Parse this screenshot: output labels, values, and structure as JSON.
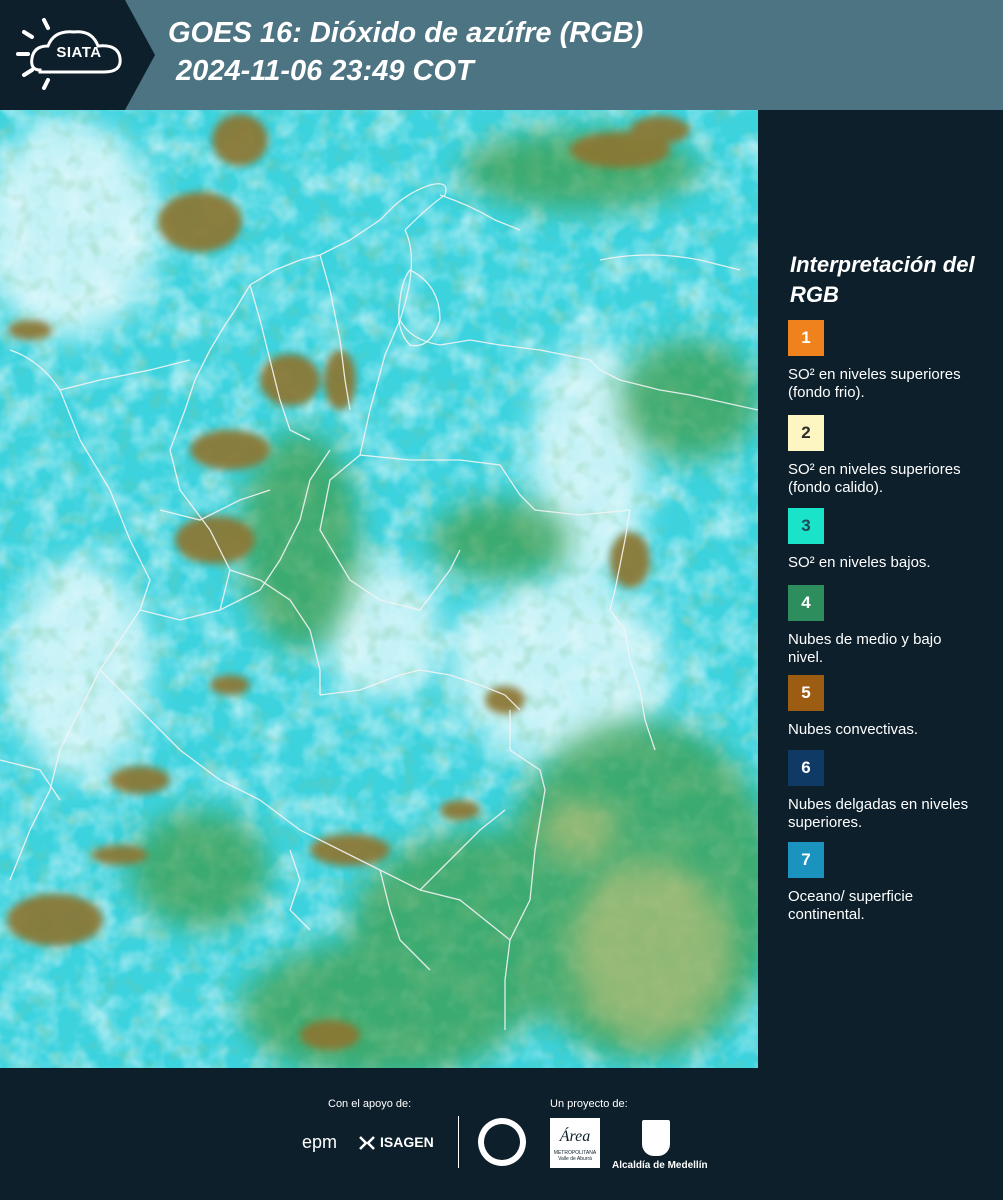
{
  "header": {
    "logo_text": "SIATA",
    "title_line1": "GOES 16: Dióxido de azúfre (RGB)",
    "title_line2": " 2024-11-06 23:49 COT"
  },
  "legend": {
    "title": "Interpretación del RGB",
    "items": [
      {
        "number": "1",
        "color": "#f0821e",
        "num_color": "#ffffff",
        "text": "SO² en niveles superiores (fondo frio)."
      },
      {
        "number": "2",
        "color": "#fdf6c2",
        "num_color": "#2b2b2b",
        "text": "SO² en niveles superiores (fondo calido)."
      },
      {
        "number": "3",
        "color": "#19e3c8",
        "num_color": "#1f4a55",
        "text": "SO² en niveles bajos."
      },
      {
        "number": "4",
        "color": "#2e8d5c",
        "num_color": "#ffffff",
        "text": "Nubes de medio y bajo nivel."
      },
      {
        "number": "5",
        "color": "#9c5c12",
        "num_color": "#ffffff",
        "text": "Nubes convectivas."
      },
      {
        "number": "6",
        "color": "#103a66",
        "num_color": "#ffffff",
        "text": "Nubes delgadas en niveles superiores."
      },
      {
        "number": "7",
        "color": "#1a93be",
        "num_color": "#ffffff",
        "text": "Oceano/ superficie continental."
      }
    ]
  },
  "footer": {
    "support_label": "Con el apoyo de:",
    "project_label": "Un proyecto de:",
    "sponsor1": "epm",
    "sponsor2": "ISAGEN",
    "area_logo_text": "Área",
    "area_logo_sub": "METROPOLITANA Valle de Aburrá",
    "alcaldia": "Alcaldía de Medellín"
  },
  "colors": {
    "header_bg": "#4d7482",
    "dark_bg": "#0c1f2b",
    "map_base": "#3fd5e0",
    "cloud_white": "#e8fbfd",
    "convective": "#8e7a3a",
    "low_cloud": "#3c9e4e"
  }
}
